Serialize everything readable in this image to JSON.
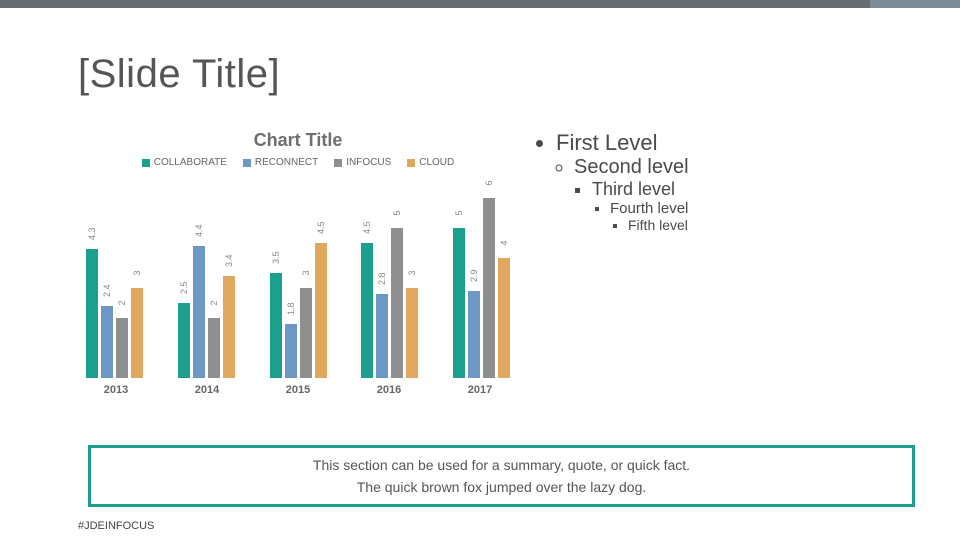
{
  "slide_title": "[Slide Title]",
  "chart_data": {
    "type": "bar",
    "title": "Chart Title",
    "categories": [
      "2013",
      "2014",
      "2015",
      "2016",
      "2017"
    ],
    "series": [
      {
        "name": "COLLABORATE",
        "color": "#1d9f8e",
        "values": [
          4.3,
          2.5,
          3.5,
          4.5,
          5
        ]
      },
      {
        "name": "RECONNECT",
        "color": "#6d98c4",
        "values": [
          2.4,
          4.4,
          1.8,
          2.8,
          2.9
        ]
      },
      {
        "name": "INFOCUS",
        "color": "#8f8f8f",
        "values": [
          2,
          2,
          3,
          5,
          6
        ]
      },
      {
        "name": "CLOUD",
        "color": "#e0a75e",
        "values": [
          3,
          3.4,
          4.5,
          3,
          4
        ]
      }
    ],
    "xlabel": "",
    "ylabel": "",
    "ylim": [
      0,
      6
    ]
  },
  "bullets": {
    "l1": "First Level",
    "l2": "Second level",
    "l3": "Third level",
    "l4": "Fourth level",
    "l5": "Fifth level"
  },
  "summary": {
    "line1": "This section can be used for a summary, quote, or quick fact.",
    "line2": "The quick brown fox jumped over the lazy dog."
  },
  "hashtag": "#JDEINFOCUS"
}
